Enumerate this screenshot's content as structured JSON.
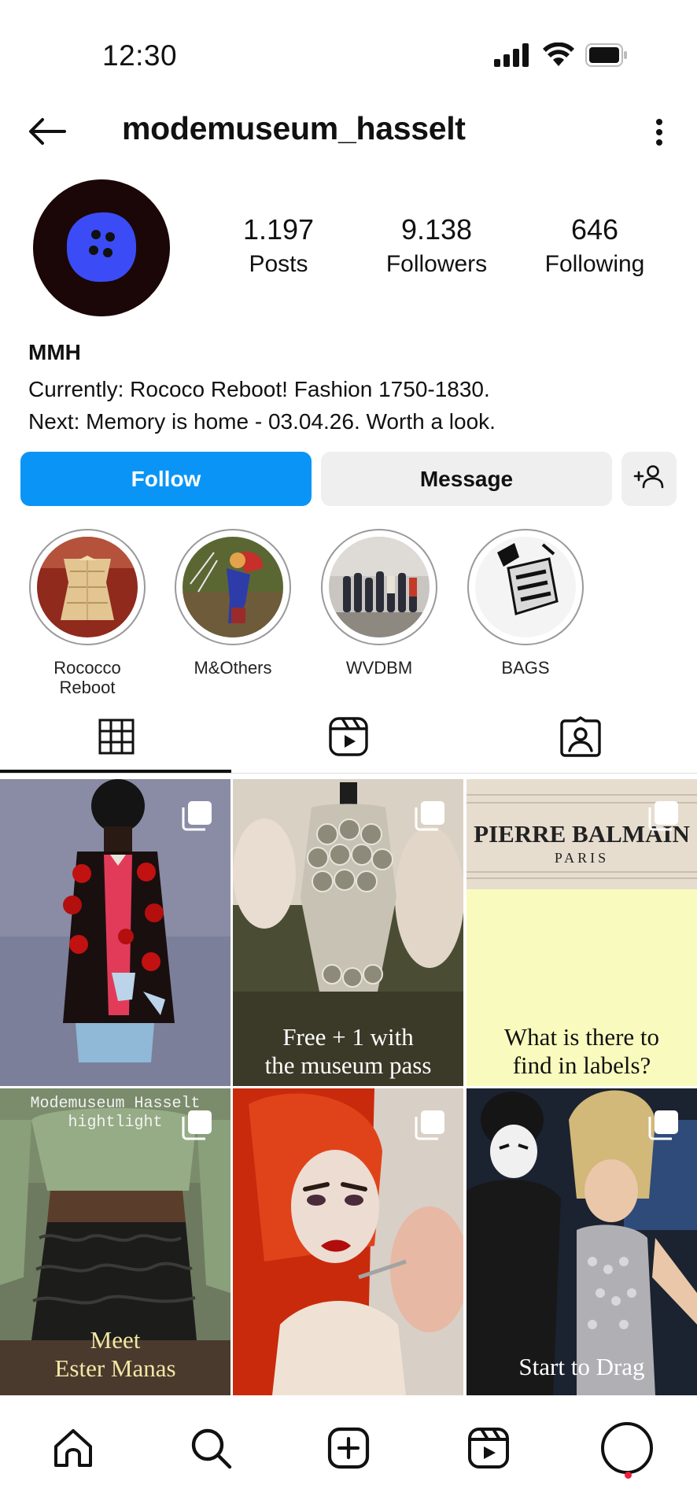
{
  "status_bar": {
    "time": "12:30",
    "icons": [
      "cellular-signal-icon",
      "wifi-icon",
      "battery-icon"
    ]
  },
  "header": {
    "username": "modemuseum_hasselt",
    "back_icon": "back-arrow-icon",
    "more_icon": "more-vertical-icon"
  },
  "profile": {
    "stats": [
      {
        "value": "1.197",
        "label": "Posts"
      },
      {
        "value": "9.138",
        "label": "Followers"
      },
      {
        "value": "646",
        "label": "Following"
      }
    ],
    "name": "MMH",
    "bio_lines": [
      "Currently: Rococo Reboot! Fashion 1750-1830.",
      "Next: Memory is home - 03.04.26. Worth a look."
    ]
  },
  "actions": {
    "follow_label": "Follow",
    "message_label": "Message",
    "add_user_icon": "add-user-icon"
  },
  "highlights": [
    {
      "label": "Rococco\nReboot"
    },
    {
      "label": "M&Others"
    },
    {
      "label": "WVDBM"
    },
    {
      "label": "BAGS"
    }
  ],
  "tabs": [
    {
      "name": "grid",
      "icon": "grid-icon",
      "active": true
    },
    {
      "name": "reels",
      "icon": "reels-icon",
      "active": false
    },
    {
      "name": "tagged",
      "icon": "tagged-icon",
      "active": false
    }
  ],
  "posts": [
    {
      "caption": ""
    },
    {
      "caption": "Free + 1 with\nthe museum pass"
    },
    {
      "caption": "What is there to\nfind in labels?",
      "label_text_1": "PIERRE BALMAIN",
      "label_text_2": "PARIS"
    },
    {
      "caption": "Meet\nEster Manas",
      "overlay": "Modemuseum Hasselt\nhightlight"
    },
    {
      "caption": ""
    },
    {
      "caption": "Start to Drag"
    }
  ],
  "bottom_nav": {
    "items": [
      "home-icon",
      "search-icon",
      "create-icon",
      "reels-icon",
      "profile-icon"
    ],
    "colors": {
      "accent": "#0a95f6",
      "notification": "#ef1f3b"
    }
  }
}
